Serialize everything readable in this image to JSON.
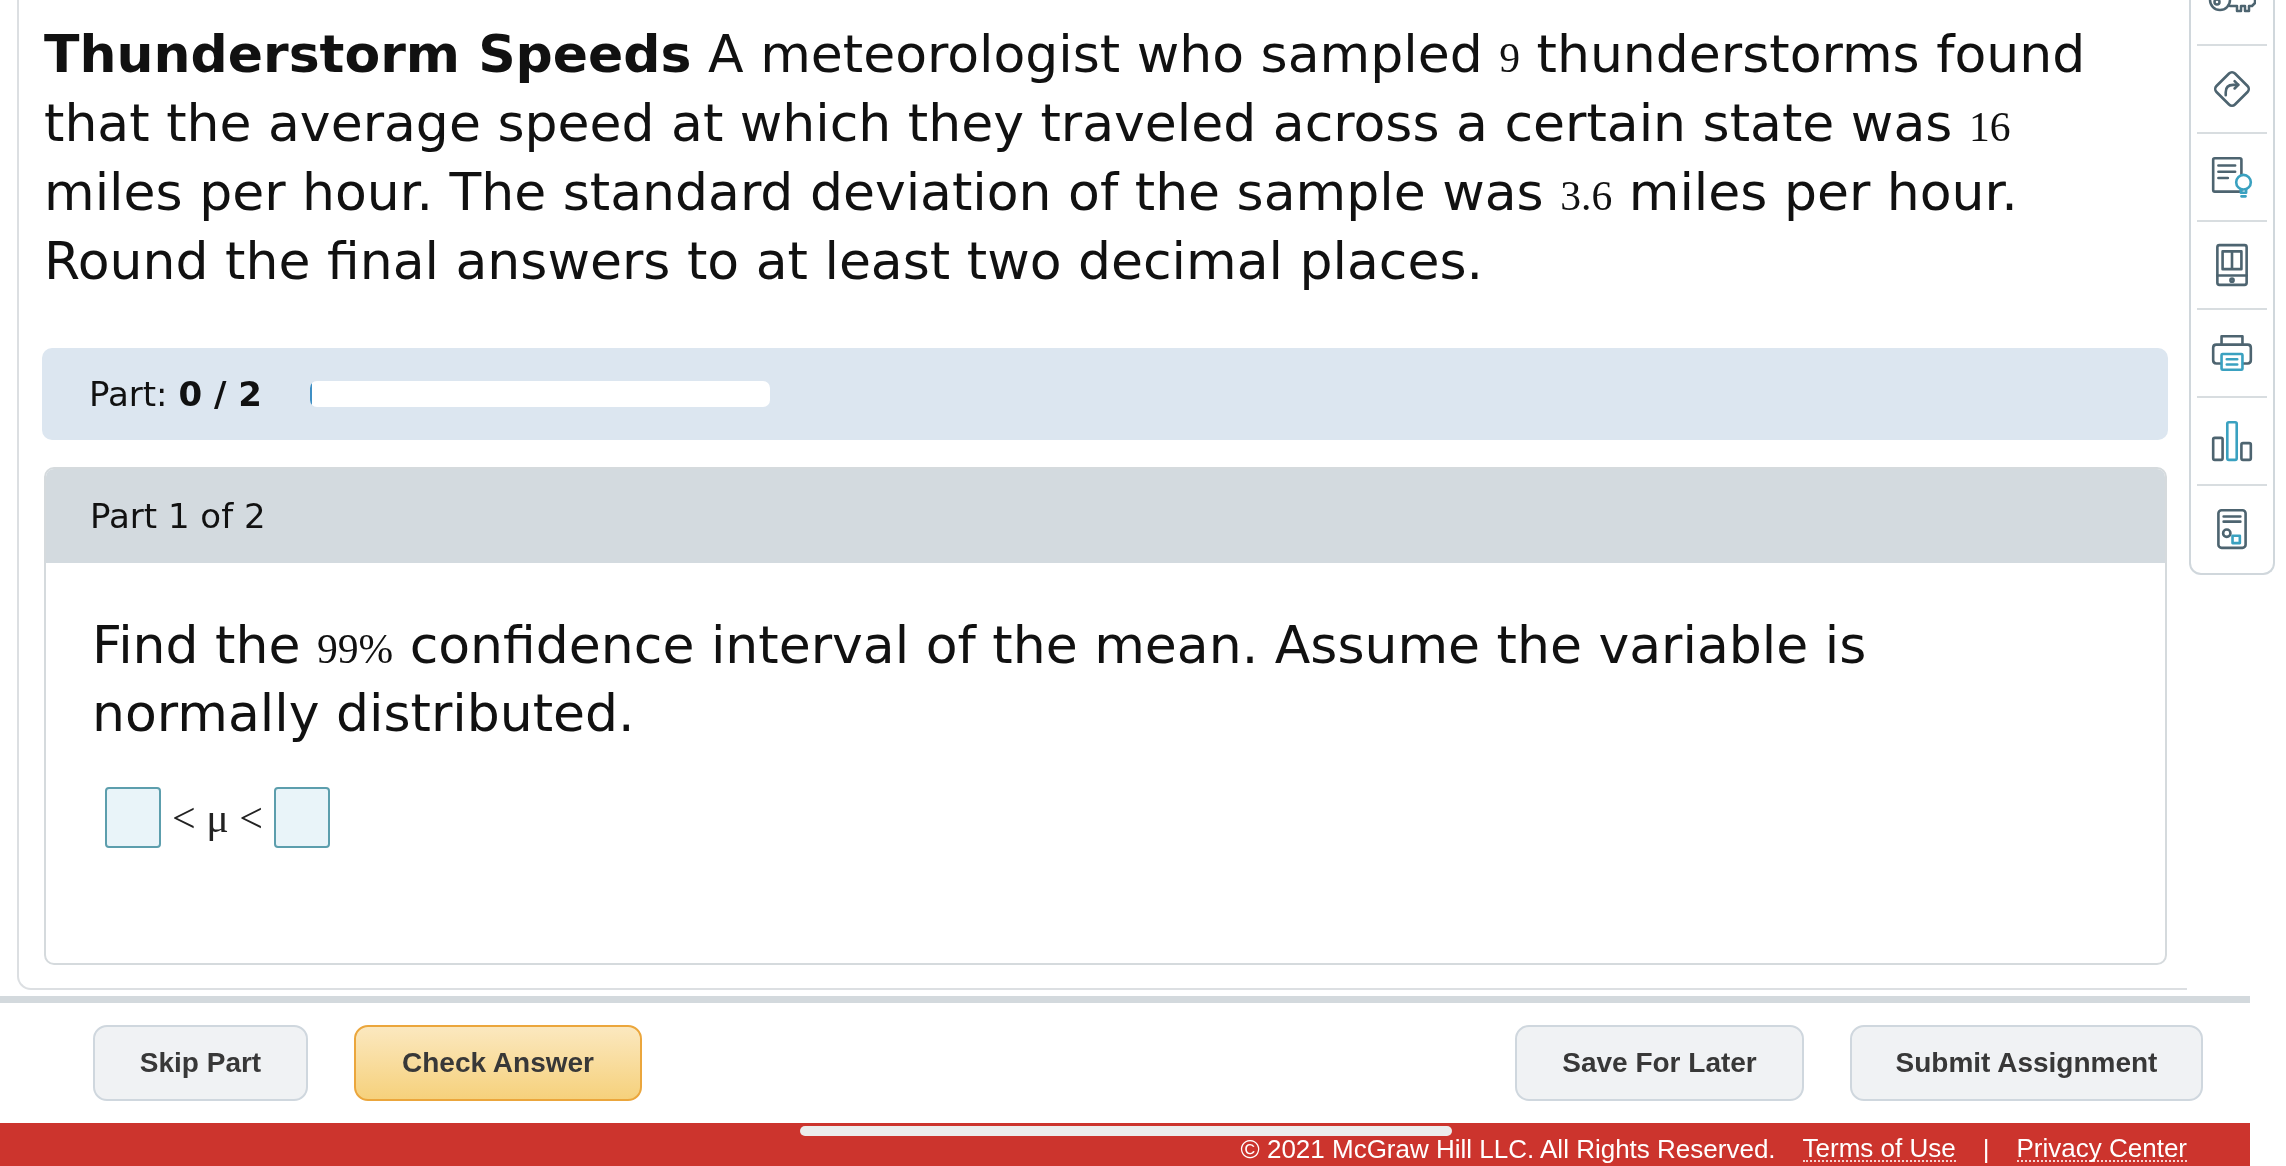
{
  "problem": {
    "segments": [
      {
        "kind": "bold",
        "text": "Thunderstorm Speeds"
      },
      {
        "kind": "text",
        "text": " A meteorologist who sampled "
      },
      {
        "kind": "math",
        "text": "9"
      },
      {
        "kind": "text",
        "text": " thunderstorms found that the average speed at which they traveled across a certain state was "
      },
      {
        "kind": "math",
        "text": "16"
      },
      {
        "kind": "text",
        "text": " miles per hour. The standard deviation of the sample was "
      },
      {
        "kind": "math",
        "text": "3.6"
      },
      {
        "kind": "text",
        "text": " miles per hour. Round the final answers to at least two decimal places."
      }
    ]
  },
  "progress": {
    "label": "Part:",
    "value": "0 / 2",
    "level": 0
  },
  "part": {
    "header": "Part 1 of 2",
    "question": [
      {
        "kind": "text",
        "text": "Find the "
      },
      {
        "kind": "math",
        "text": "99%"
      },
      {
        "kind": "text",
        "text": " confidence interval of the mean. Assume the variable is normally distributed."
      }
    ],
    "answer": [
      {
        "kind": "field"
      },
      {
        "kind": "text",
        "text": "< μ <"
      },
      {
        "kind": "field"
      }
    ]
  },
  "actions": {
    "left": [
      {
        "label": "Skip Part",
        "kind": "secondary"
      },
      {
        "label": "Check Answer",
        "kind": "primary"
      }
    ],
    "right": [
      {
        "label": "Save For Later",
        "kind": "secondary"
      },
      {
        "label": "Submit Assignment",
        "kind": "secondary"
      }
    ]
  },
  "footer": {
    "copyright": "© 2021 McGraw Hill LLC. All Rights Reserved.",
    "links": [
      "Terms of Use",
      "Privacy Center"
    ],
    "separator": "|"
  }
}
